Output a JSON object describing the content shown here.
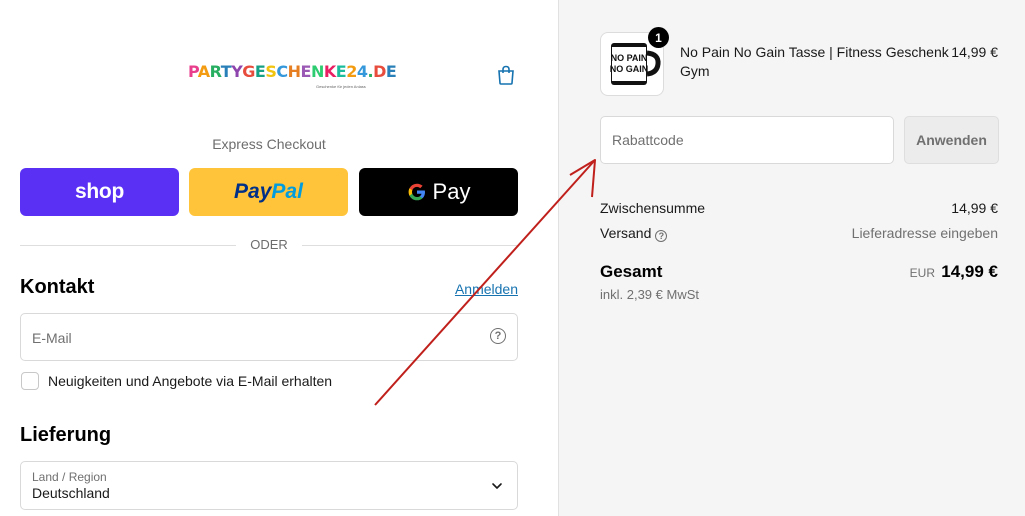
{
  "logo": {
    "text": "PARTYGESCHENKE24.DE",
    "tagline": "Geschenke für jeden Anlass"
  },
  "express": {
    "label": "Express Checkout",
    "shop_label": "shop",
    "paypal_part1": "Pay",
    "paypal_part2": "Pal",
    "gpay_label": "Pay",
    "or_label": "ODER"
  },
  "contact": {
    "heading": "Kontakt",
    "login_link": "Anmelden",
    "email_placeholder": "E-Mail",
    "newsletter_label": "Neuigkeiten und Angebote via E-Mail erhalten"
  },
  "delivery": {
    "heading": "Lieferung",
    "country_label": "Land / Region",
    "country_value": "Deutschland"
  },
  "order": {
    "product": {
      "name": "No Pain No Gain Tasse | Fitness Geschenk Gym",
      "price": "14,99 €",
      "quantity": "1",
      "mug_text_1": "NO PAIN",
      "mug_text_2": "NO GAIN"
    },
    "discount_placeholder": "Rabattcode",
    "apply_label": "Anwenden",
    "subtotal_label": "Zwischensumme",
    "subtotal_value": "14,99 €",
    "shipping_label": "Versand",
    "shipping_value": "Lieferadresse eingeben",
    "total_label": "Gesamt",
    "tax_note": "inkl. 2,39 € MwSt",
    "currency": "EUR",
    "total_value": "14,99 €"
  },
  "colors": {
    "shop": "#5a31f4",
    "paypal": "#ffc439",
    "link": "#1773b0",
    "arrow": "#c0201c"
  }
}
